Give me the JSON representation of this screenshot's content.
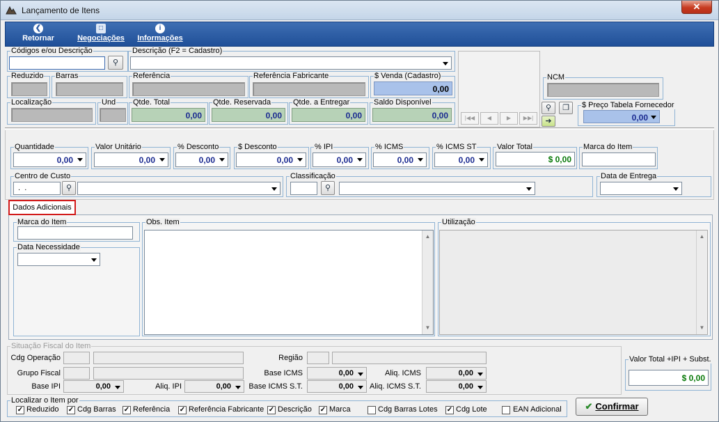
{
  "window": {
    "title": "Lançamento de Itens",
    "close_label": "✕"
  },
  "toolbar": {
    "retornar": "Retornar",
    "negociacoes": "Negociações",
    "informacoes": "Informações"
  },
  "header": {
    "codigos_label": "Códigos e/ou Descrição",
    "descricao_label": "Descrição (F2 = Cadastro)",
    "reduzido_label": "Reduzido",
    "barras_label": "Barras",
    "referencia_label": "Referência",
    "ref_fabricante_label": "Referência Fabricante",
    "venda_label": "$ Venda (Cadastro)",
    "venda_value": "0,00",
    "localizacao_label": "Localização",
    "und_label": "Und",
    "qtde_total_label": "Qtde. Total",
    "qtde_total_value": "0,00",
    "qtde_reservada_label": "Qtde. Reservada",
    "qtde_reservada_value": "0,00",
    "qtde_entregar_label": "Qtde. a Entregar",
    "qtde_entregar_value": "0,00",
    "saldo_label": "Saldo Disponível",
    "saldo_value": "0,00",
    "ncm_label": "NCM",
    "preco_tabela_label": "$ Preço Tabela Fornecedor",
    "preco_tabela_value": "0,00"
  },
  "item": {
    "quantidade_label": "Quantidade",
    "quantidade_value": "0,00",
    "valor_unitario_label": "Valor Unitário",
    "valor_unitario_value": "0,00",
    "pct_desconto_label": "% Desconto",
    "pct_desconto_value": "0,00",
    "desconto_label": "$ Desconto",
    "desconto_value": "0,00",
    "pct_ipi_label": "% IPI",
    "pct_ipi_value": "0,00",
    "pct_icms_label": "% ICMS",
    "pct_icms_value": "0,00",
    "pct_icms_st_label": "% ICMS ST",
    "pct_icms_st_value": "0,00",
    "valor_total_label": "Valor Total",
    "valor_total_value": "$ 0,00",
    "marca_label": "Marca do Item",
    "centro_custo_label": "Centro de Custo",
    "centro_custo_value": " .  .",
    "classificacao_label": "Classificação",
    "data_entrega_label": "Data de Entrega"
  },
  "tabs": {
    "dados_adicionais": "Dados Adicionais"
  },
  "adicionais": {
    "marca_label": "Marca do Item",
    "data_necessidade_label": "Data Necessidade",
    "obs_label": "Obs. Item",
    "utilizacao_label": "Utilização"
  },
  "fiscal": {
    "group_label": "Situação Fiscal do Item",
    "cdg_operacao": "Cdg Operação",
    "grupo_fiscal": "Grupo Fiscal",
    "base_ipi": "Base IPI",
    "base_ipi_value": "0,00",
    "aliq_ipi": "Aliq. IPI",
    "aliq_ipi_value": "0,00",
    "regiao": "Região",
    "base_icms": "Base ICMS",
    "base_icms_value": "0,00",
    "aliq_icms": "Aliq. ICMS",
    "aliq_icms_value": "0,00",
    "base_icms_st": "Base ICMS S.T.",
    "base_icms_st_value": "0,00",
    "aliq_icms_st": "Aliq. ICMS S.T.",
    "aliq_icms_st_value": "0,00",
    "total_label": "Valor Total +IPI + Subst.",
    "total_value": "$ 0,00"
  },
  "localizar": {
    "label": "Localizar o Item por",
    "options": [
      {
        "label": "Reduzido",
        "checked": true
      },
      {
        "label": "Cdg Barras",
        "checked": true
      },
      {
        "label": "Referência",
        "checked": true
      },
      {
        "label": "Referência Fabricante",
        "checked": true
      },
      {
        "label": "Descrição",
        "checked": true
      },
      {
        "label": "Marca",
        "checked": true
      },
      {
        "label": "Cdg Barras Lotes",
        "checked": false
      },
      {
        "label": "Cdg Lote",
        "checked": true
      },
      {
        "label": "EAN Adicional",
        "checked": false
      }
    ]
  },
  "confirm_label": "Confirmar",
  "colors": {
    "toolbar": "#1f4f98",
    "accent_green": "#0a7a0a",
    "value_blue": "#1a2a90"
  }
}
